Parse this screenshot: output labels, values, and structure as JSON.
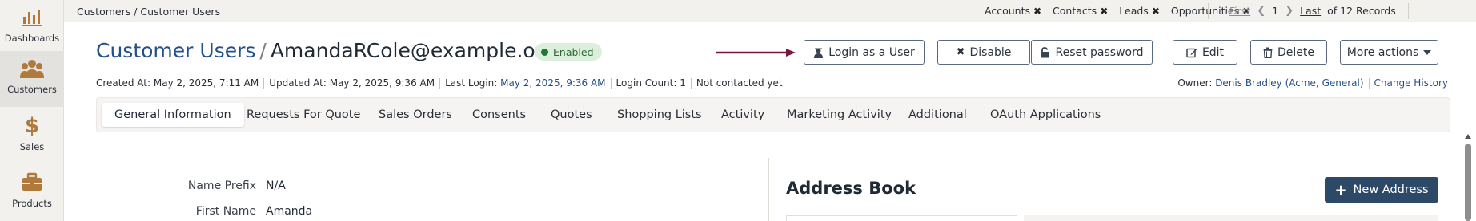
{
  "sidebar": {
    "items": [
      {
        "label": "Dashboards",
        "icon": "bar-chart-icon"
      },
      {
        "label": "Customers",
        "icon": "users-icon",
        "active": true
      },
      {
        "label": "Sales",
        "icon": "dollar-icon"
      },
      {
        "label": "Products",
        "icon": "briefcase-icon"
      }
    ]
  },
  "topbar": {
    "breadcrumb": "Customers / Customer Users",
    "pinned": [
      {
        "label": "Accounts"
      },
      {
        "label": "Contacts"
      },
      {
        "label": "Leads"
      },
      {
        "label": "Opportunities"
      }
    ],
    "pager": {
      "first": "First",
      "page": "1",
      "last": "Last",
      "records": "of 12 Records"
    }
  },
  "header": {
    "entity": "Customer Users",
    "record_name": "AmandaRCole@example.org",
    "status": "Enabled"
  },
  "actions": {
    "login_as_user": "Login as a User",
    "disable": "Disable",
    "reset_password": "Reset password",
    "edit": "Edit",
    "delete": "Delete",
    "more_actions": "More actions"
  },
  "meta": {
    "created": "Created At: May 2, 2025, 7:11 AM",
    "updated": "Updated At: May 2, 2025, 9:36 AM",
    "last_login_label": "Last Login:",
    "last_login_value": "May 2, 2025, 9:36 AM",
    "login_count": "Login Count: 1",
    "contacted": "Not contacted yet",
    "owner_label": "Owner:",
    "owner_value": "Denis Bradley (Acme, General)",
    "change_history": "Change History"
  },
  "tabs": [
    "General Information",
    "Requests For Quote",
    "Sales Orders",
    "Consents",
    "Quotes",
    "Shopping Lists",
    "Activity",
    "Marketing Activity",
    "Additional",
    "OAuth Applications"
  ],
  "fields": [
    {
      "label": "Name Prefix",
      "value": "N/A"
    },
    {
      "label": "First Name",
      "value": "Amanda"
    }
  ],
  "address_book": {
    "title": "Address Book",
    "new_address": "New Address"
  },
  "colors": {
    "accent": "#24508a",
    "primary_button": "#2d4968",
    "status_green": "#1e7a2f",
    "arrow": "#7a1440"
  }
}
